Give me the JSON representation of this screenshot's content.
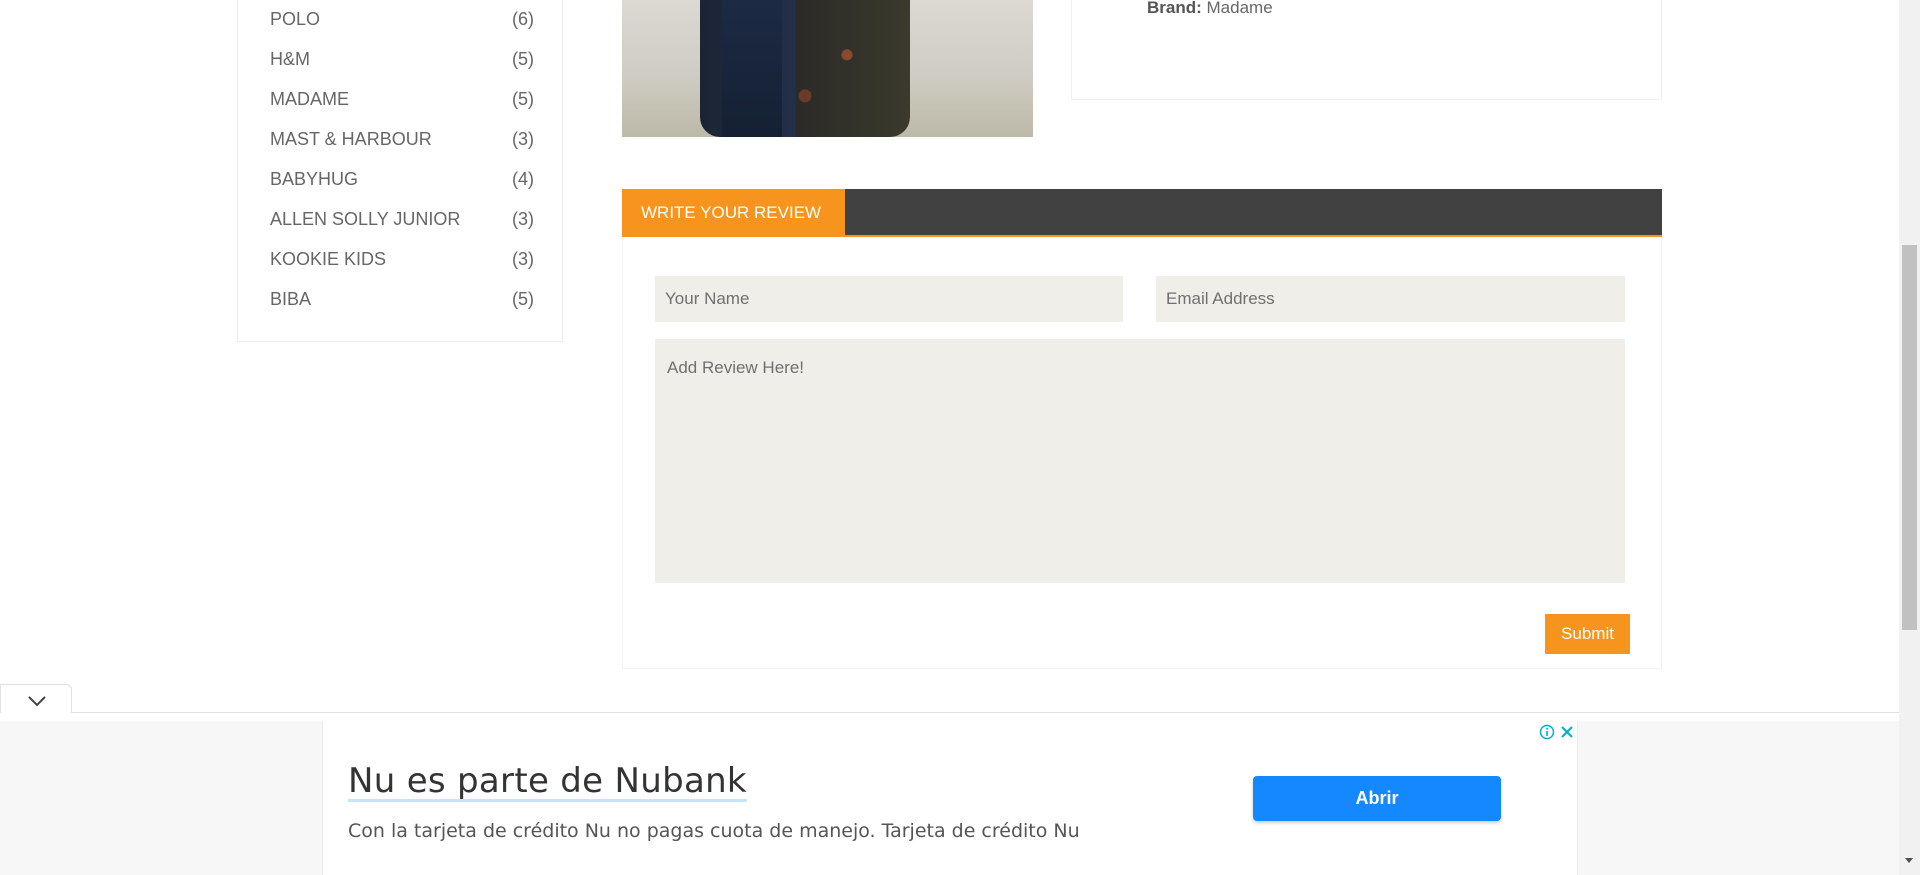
{
  "sidebar": {
    "brands": [
      {
        "name": "POLO",
        "count": "(6)"
      },
      {
        "name": "H&M",
        "count": "(5)"
      },
      {
        "name": "MADAME",
        "count": "(5)"
      },
      {
        "name": "MAST & HARBOUR",
        "count": "(3)"
      },
      {
        "name": "BABYHUG",
        "count": "(4)"
      },
      {
        "name": "ALLEN SOLLY JUNIOR",
        "count": "(3)"
      },
      {
        "name": "KOOKIE KIDS",
        "count": "(3)"
      },
      {
        "name": "BIBA",
        "count": "(5)"
      }
    ]
  },
  "product": {
    "brand_label": "Brand:",
    "brand_value": "Madame"
  },
  "review": {
    "tab_label": "WRITE YOUR REVIEW",
    "name_placeholder": "Your Name",
    "email_placeholder": "Email Address",
    "review_placeholder": "Add Review Here!",
    "submit_label": "Submit"
  },
  "ad": {
    "title": "Nu es parte de Nubank",
    "description": "Con la tarjeta de crédito Nu no pagas cuota de manejo. Tarjeta de crédito Nu",
    "button_label": "Abrir",
    "button_color": "#1488ff"
  },
  "colors": {
    "accent": "#f7941d",
    "header_dark": "#414141",
    "field_bg": "#efeee8"
  }
}
